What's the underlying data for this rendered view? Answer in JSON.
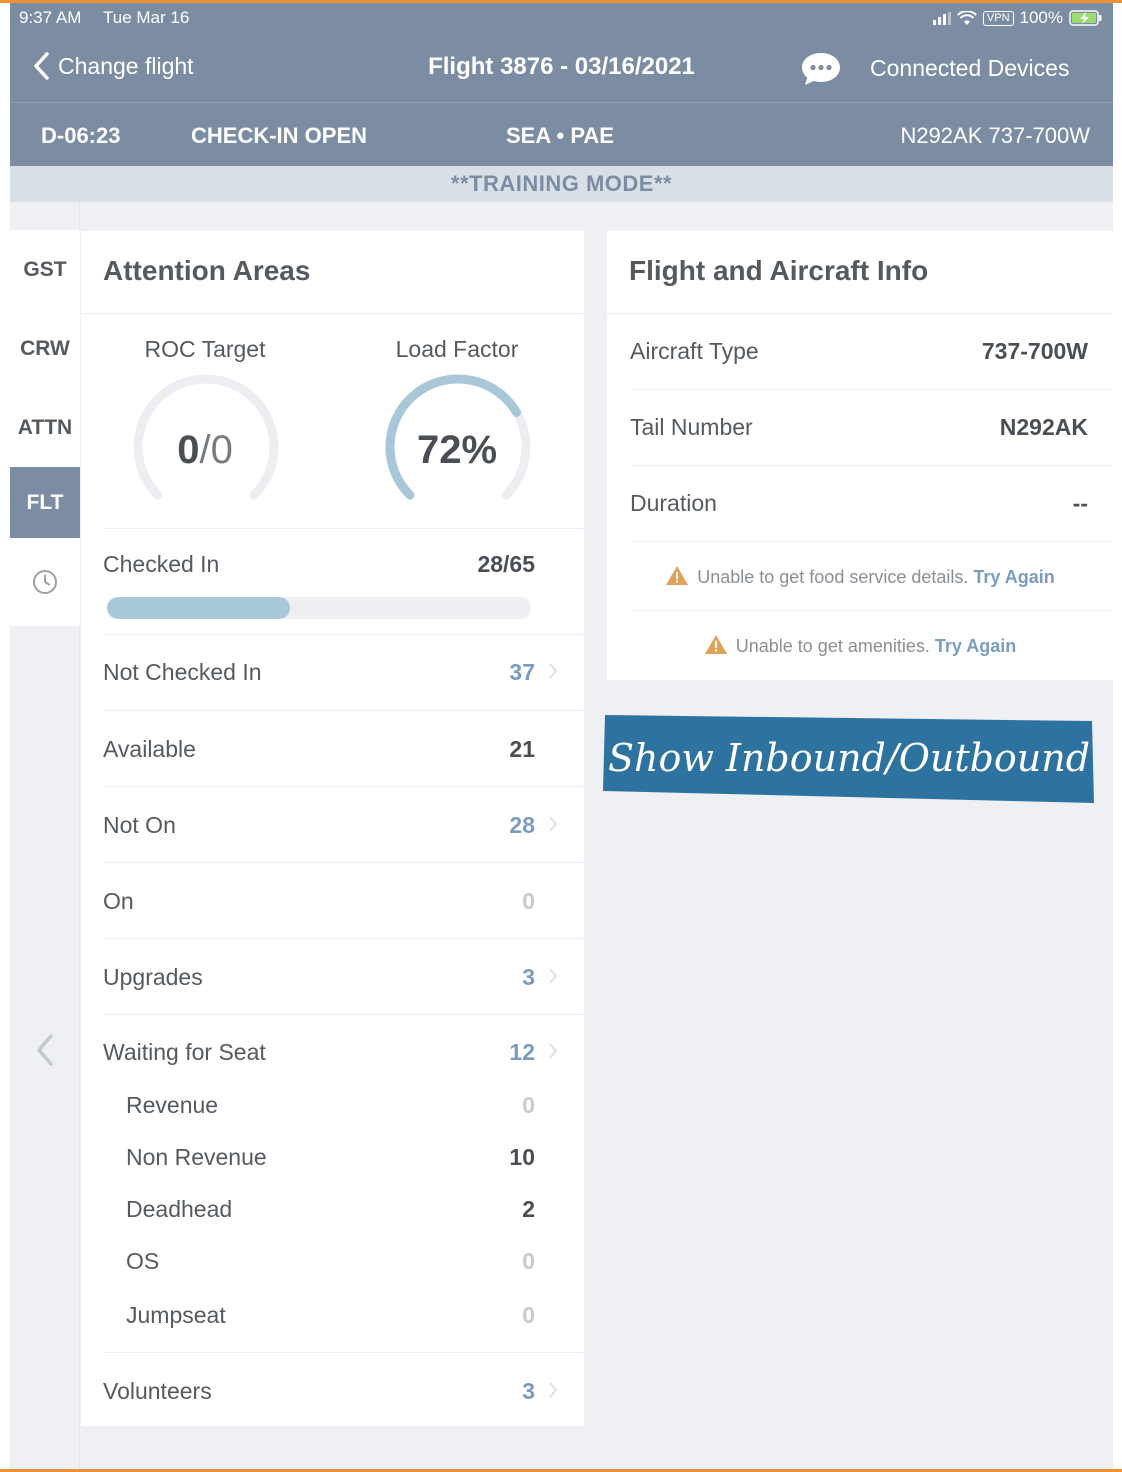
{
  "status_bar": {
    "time": "9:37 AM",
    "date": "Tue Mar 16",
    "vpn": "VPN",
    "battery": "100%"
  },
  "nav": {
    "back_label": "Change flight",
    "title": "Flight 3876 - 03/16/2021",
    "chat_icon": "chat-bubble-icon",
    "connected_devices": "Connected Devices"
  },
  "flight_bar": {
    "countdown": "D-06:23",
    "status": "CHECK-IN OPEN",
    "route": "SEA • PAE",
    "aircraft": "N292AK 737-700W"
  },
  "training_banner": "**TRAINING MODE**",
  "side_tabs": [
    {
      "label": "GST",
      "active": false
    },
    {
      "label": "CRW",
      "active": false
    },
    {
      "label": "ATTN",
      "active": false
    },
    {
      "label": "FLT",
      "active": true
    }
  ],
  "side_icons": [
    "clock-icon",
    "chevron-left-icon"
  ],
  "attention": {
    "title": "Attention Areas",
    "roc_target": {
      "label": "ROC Target",
      "value_main": "0",
      "value_rest": "0",
      "separator": "/"
    },
    "load_factor": {
      "label": "Load Factor",
      "value": "72%",
      "fraction": 0.72
    },
    "checked_in": {
      "label": "Checked In",
      "value": "28/65",
      "fraction": 0.4308
    },
    "rows": [
      {
        "label": "Not Checked In",
        "value": "37",
        "link": true
      },
      {
        "label": "Available",
        "value": "21",
        "link": false
      },
      {
        "label": "Not On",
        "value": "28",
        "link": true
      },
      {
        "label": "On",
        "value": "0",
        "link": false
      },
      {
        "label": "Upgrades",
        "value": "3",
        "link": true
      },
      {
        "label": "Waiting for Seat",
        "value": "12",
        "link": true
      },
      {
        "label": "Revenue",
        "value": "0",
        "link": false
      },
      {
        "label": "Non Revenue",
        "value": "10",
        "link": false
      },
      {
        "label": "Deadhead",
        "value": "2",
        "link": false
      },
      {
        "label": "OS",
        "value": "0",
        "link": false
      },
      {
        "label": "Jumpseat",
        "value": "0",
        "link": false
      },
      {
        "label": "Volunteers",
        "value": "3",
        "link": true
      }
    ]
  },
  "flight_info": {
    "title": "Flight and Aircraft Info",
    "rows": [
      {
        "label": "Aircraft Type",
        "value": "737-700W"
      },
      {
        "label": "Tail Number",
        "value": "N292AK"
      },
      {
        "label": "Duration",
        "value": "--"
      }
    ],
    "warnings": [
      {
        "text": "Unable to get food service details.",
        "action": "Try Again"
      },
      {
        "text": "Unable to get amenities.",
        "action": "Try Again"
      }
    ]
  },
  "handwritten_note": "Show Inbound/Outbound",
  "colors": {
    "header": "#7c8da3",
    "link": "#7a9cc0",
    "progress": "#a8c8da",
    "note_bg": "#2e73a0",
    "warning": "#e0a25a"
  }
}
